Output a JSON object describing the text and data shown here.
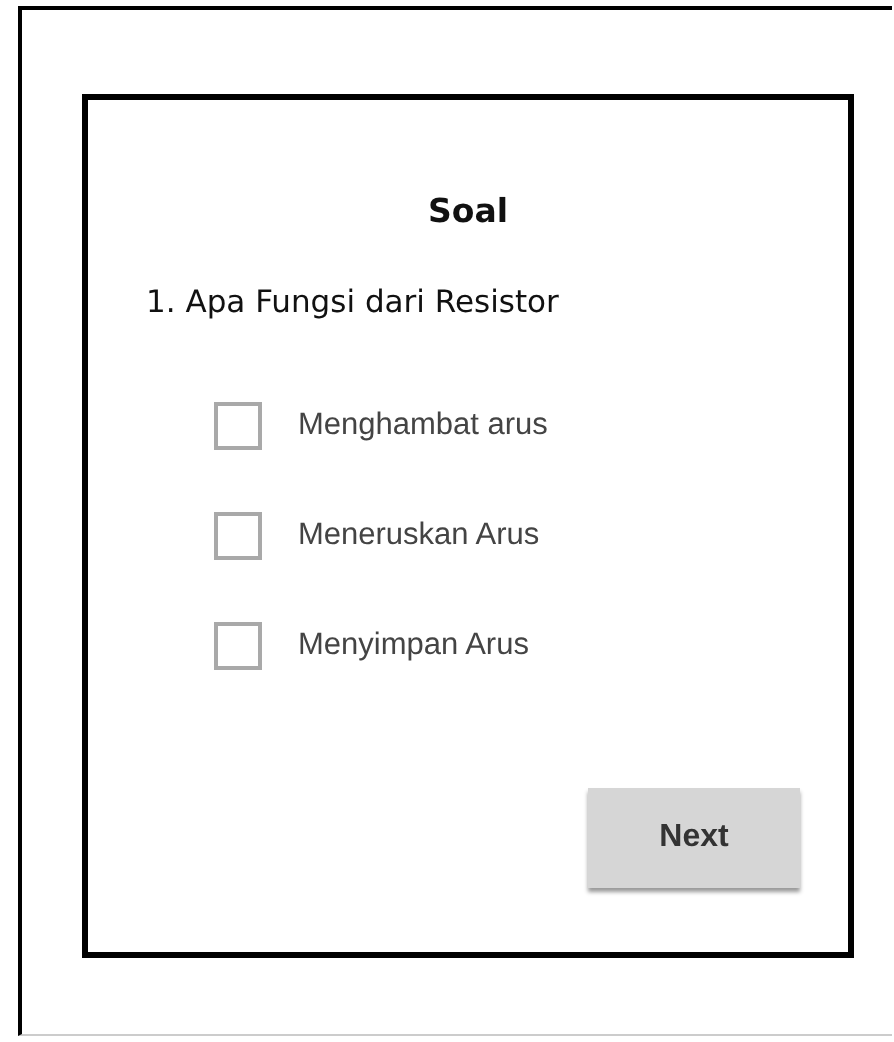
{
  "quiz": {
    "title": "Soal",
    "question": "1. Apa Fungsi dari Resistor",
    "options": [
      {
        "label": "Menghambat arus",
        "checked": false
      },
      {
        "label": "Meneruskan Arus",
        "checked": false
      },
      {
        "label": "Menyimpan Arus",
        "checked": false
      }
    ],
    "button": "Next"
  }
}
